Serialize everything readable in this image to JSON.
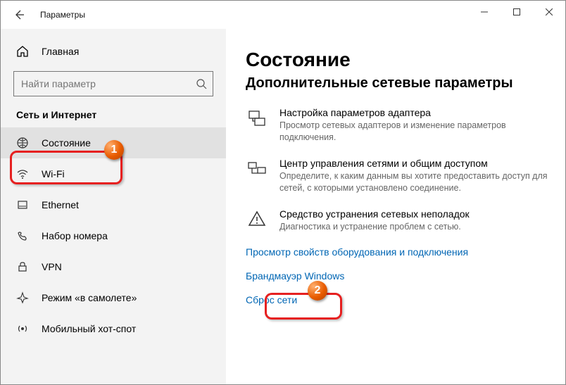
{
  "titlebar": {
    "title": "Параметры"
  },
  "search": {
    "placeholder": "Найти параметр"
  },
  "sidebar": {
    "home": "Главная",
    "section": "Сеть и Интернет",
    "items": [
      {
        "label": "Состояние"
      },
      {
        "label": "Wi-Fi"
      },
      {
        "label": "Ethernet"
      },
      {
        "label": "Набор номера"
      },
      {
        "label": "VPN"
      },
      {
        "label": "Режим «в самолете»"
      },
      {
        "label": "Мобильный хот-спот"
      }
    ]
  },
  "content": {
    "h1": "Состояние",
    "h2": "Дополнительные сетевые параметры",
    "rows": [
      {
        "title": "Настройка параметров адаптера",
        "desc": "Просмотр сетевых адаптеров и изменение параметров подключения."
      },
      {
        "title": "Центр управления сетями и общим доступом",
        "desc": "Определите, к каким данным вы хотите предоставить доступ для сетей, с которыми установлено соединение."
      },
      {
        "title": "Средство устранения сетевых неполадок",
        "desc": "Диагностика и устранение проблем с сетью."
      }
    ],
    "links": [
      "Просмотр свойств оборудования и подключения",
      "Брандмауэр Windows",
      "Сброс сети"
    ]
  },
  "badges": {
    "b1": "1",
    "b2": "2"
  }
}
